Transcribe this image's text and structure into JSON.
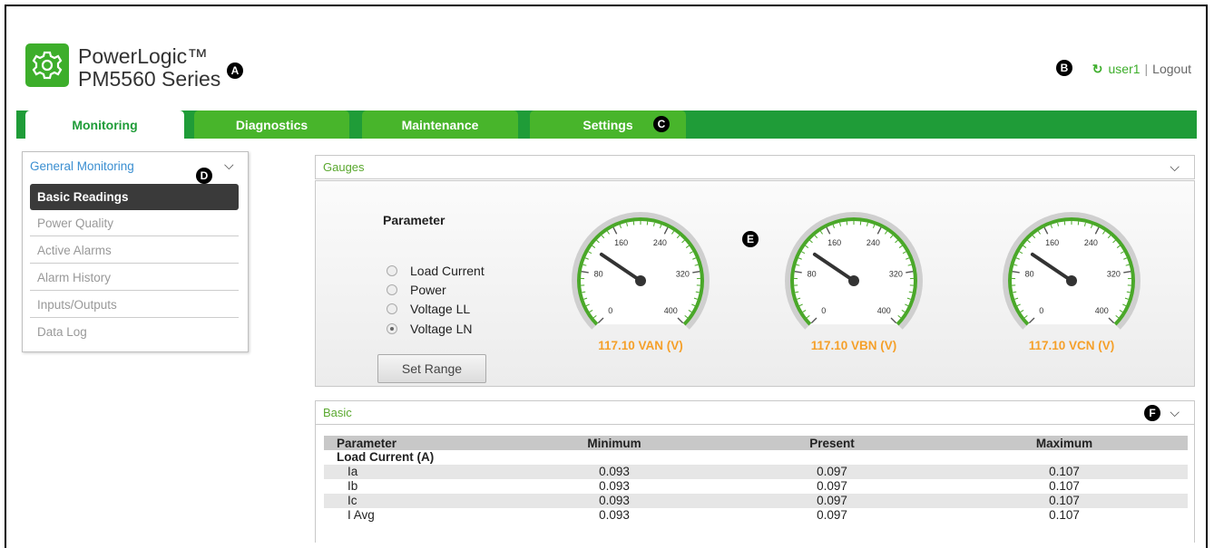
{
  "brand": {
    "line1": "PowerLogic™",
    "line2": "PM5560 Series",
    "accent": "#3dae2b",
    "icon": "gear-icon"
  },
  "callouts": {
    "a": "A",
    "b": "B",
    "c": "C",
    "d": "D",
    "e": "E",
    "f": "F"
  },
  "user": {
    "icon": "refresh-icon",
    "name": "user1",
    "separator": "|",
    "logout": "Logout"
  },
  "nav": {
    "tabs": [
      {
        "label": "Monitoring",
        "active": true
      },
      {
        "label": "Diagnostics"
      },
      {
        "label": "Maintenance"
      },
      {
        "label": "Settings"
      }
    ]
  },
  "sidebar": {
    "title": "General Monitoring",
    "items": [
      {
        "label": "Basic Readings",
        "active": true
      },
      {
        "label": "Power Quality"
      },
      {
        "label": "Active Alarms"
      },
      {
        "label": "Alarm History"
      },
      {
        "label": "Inputs/Outputs"
      },
      {
        "label": "Data Log"
      }
    ]
  },
  "gauges_panel": {
    "title": "Gauges",
    "parameter_title": "Parameter",
    "options": [
      {
        "label": "Load Current",
        "selected": false
      },
      {
        "label": "Power",
        "selected": false
      },
      {
        "label": "Voltage LL",
        "selected": false
      },
      {
        "label": "Voltage LN",
        "selected": true
      }
    ],
    "set_range": "Set Range",
    "scale_labels": [
      "0",
      "80",
      "160",
      "240",
      "320",
      "400"
    ],
    "gauges": [
      {
        "value": 117.1,
        "label": "117.10 VAN (V)"
      },
      {
        "value": 117.1,
        "label": "117.10 VBN (V)"
      },
      {
        "value": 117.1,
        "label": "117.10 VCN (V)"
      }
    ]
  },
  "basic_panel": {
    "title": "Basic",
    "columns": [
      "Parameter",
      "Minimum",
      "Present",
      "Maximum"
    ],
    "section": "Load Current (A)",
    "rows": [
      {
        "name": "Ia",
        "min": "0.093",
        "present": "0.097",
        "max": "0.107"
      },
      {
        "name": "Ib",
        "min": "0.093",
        "present": "0.097",
        "max": "0.107"
      },
      {
        "name": "Ic",
        "min": "0.093",
        "present": "0.097",
        "max": "0.107"
      },
      {
        "name": "I Avg",
        "min": "0.093",
        "present": "0.097",
        "max": "0.107"
      }
    ]
  }
}
